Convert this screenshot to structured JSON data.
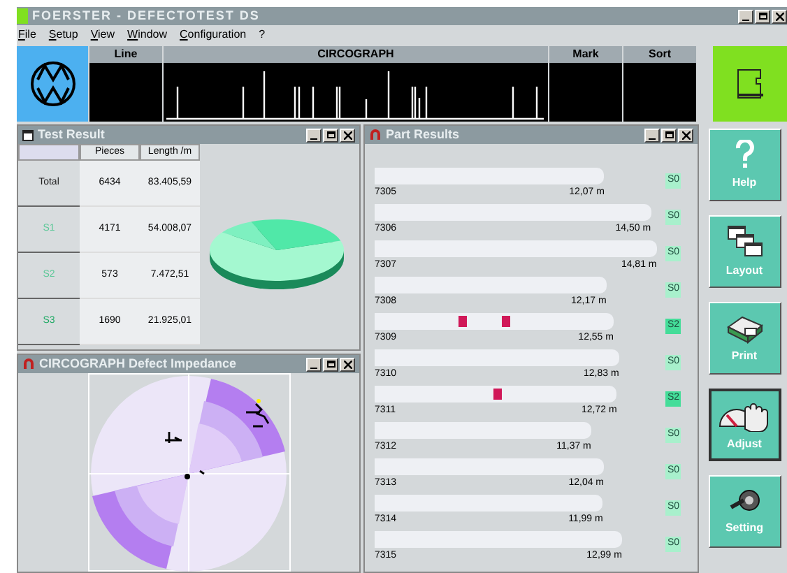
{
  "window": {
    "title": "FOERSTER - DEFECTOTEST DS"
  },
  "menu": [
    "File",
    "Setup",
    "View",
    "Window",
    "Configuration",
    "?"
  ],
  "header": {
    "columns": [
      "Line",
      "CIRCOGRAPH",
      "Mark",
      "Sort"
    ]
  },
  "test_result": {
    "title": "Test Result",
    "columns": [
      "Pieces",
      "Length /m"
    ],
    "rows": [
      {
        "label": "Total",
        "color": "#222222",
        "pieces": "6434",
        "length": "83.405,59"
      },
      {
        "label": "S1",
        "color": "#5cc898",
        "pieces": "4171",
        "length": "54.008,07"
      },
      {
        "label": "S2",
        "color": "#5cc898",
        "pieces": "573",
        "length": "7.472,51"
      },
      {
        "label": "S3",
        "color": "#22aa66",
        "pieces": "1690",
        "length": "21.925,01"
      }
    ]
  },
  "defect_impedance": {
    "title": "CIRCOGRAPH Defect Impedance"
  },
  "part_results": {
    "title": "Part Results",
    "parts": [
      {
        "id": "7305",
        "length": "12,07 m",
        "status": "S0",
        "color": "#a8f0cc"
      },
      {
        "id": "7306",
        "length": "14,50 m",
        "status": "S0",
        "color": "#a8f0cc"
      },
      {
        "id": "7307",
        "length": "14,81 m",
        "status": "S0",
        "color": "#a8f0cc"
      },
      {
        "id": "7308",
        "length": "12,17 m",
        "status": "S0",
        "color": "#a8f0cc"
      },
      {
        "id": "7309",
        "length": "12,55 m",
        "status": "S2",
        "color": "#44dd99",
        "defects": [
          {
            "kind": "defect"
          },
          {
            "kind": "defect"
          }
        ]
      },
      {
        "id": "7310",
        "length": "12,83 m",
        "status": "S0",
        "color": "#a8f0cc"
      },
      {
        "id": "7311",
        "length": "12,72 m",
        "status": "S2",
        "color": "#44dd99",
        "defects": [
          {
            "kind": "defect"
          }
        ]
      },
      {
        "id": "7312",
        "length": "11,37 m",
        "status": "S0",
        "color": "#a8f0cc"
      },
      {
        "id": "7313",
        "length": "12,04 m",
        "status": "S0",
        "color": "#a8f0cc"
      },
      {
        "id": "7314",
        "length": "11,99 m",
        "status": "S0",
        "color": "#a8f0cc"
      },
      {
        "id": "7315",
        "length": "12,99 m",
        "status": "S0",
        "color": "#a8f0cc"
      }
    ]
  },
  "toolbar": [
    {
      "kind": "help",
      "label": "Help",
      "selected": false
    },
    {
      "kind": "layout",
      "label": "Layout",
      "selected": false
    },
    {
      "kind": "print",
      "label": "Print",
      "selected": false
    },
    {
      "kind": "adjust",
      "label": "Adjust",
      "selected": true
    },
    {
      "kind": "setting",
      "label": "Setting",
      "selected": false
    }
  ]
}
